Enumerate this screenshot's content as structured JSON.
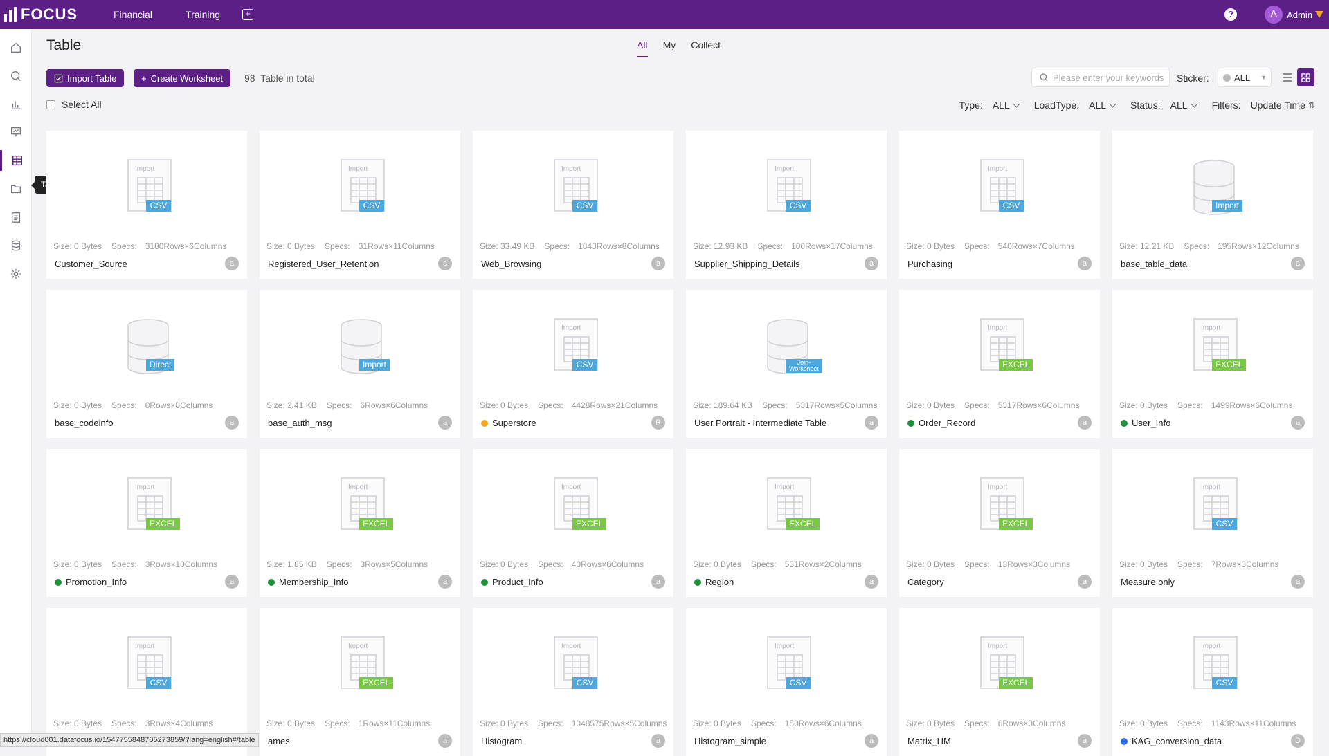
{
  "app": {
    "name": "FOCUS"
  },
  "topnav": {
    "items": [
      "Financial",
      "Training"
    ],
    "add_symbol": "+"
  },
  "user": {
    "initial": "A",
    "name": "Admin",
    "help": "?"
  },
  "sidebar": {
    "items": [
      {
        "icon": "home-icon"
      },
      {
        "icon": "search-icon"
      },
      {
        "icon": "chart-icon"
      },
      {
        "icon": "presentation-icon"
      },
      {
        "icon": "table-icon",
        "active": true
      },
      {
        "icon": "folder-icon"
      },
      {
        "icon": "clipboard-icon"
      },
      {
        "icon": "database-icon"
      },
      {
        "icon": "gear-icon"
      }
    ],
    "tooltip": "Tables"
  },
  "page": {
    "title": "Table"
  },
  "tabs": [
    {
      "label": "All",
      "active": true
    },
    {
      "label": "My"
    },
    {
      "label": "Collect"
    }
  ],
  "toolbar": {
    "import_label": "Import Table",
    "create_label": "Create Worksheet",
    "count_num": "98",
    "count_text": "Table in total",
    "search_placeholder": "Please enter your keywords",
    "sticker_label": "Sticker:",
    "sticker_value": "ALL",
    "select_all": "Select All"
  },
  "filters": {
    "type_label": "Type:",
    "type_value": "ALL",
    "load_label": "LoadType:",
    "load_value": "ALL",
    "status_label": "Status:",
    "status_value": "ALL",
    "filters_label": "Filters:",
    "sort_value": "Update Time"
  },
  "colors": {
    "brand": "#5c1f85",
    "csv": "#4da8e0",
    "excel": "#7ac943",
    "green": "#1e8f3a",
    "orange": "#f5a623",
    "blue": "#2b6be0"
  },
  "cards": [
    {
      "name": "Customer_Source",
      "size": "Size: 0 Bytes",
      "specs": "3180Rows×6Columns",
      "kind": "table",
      "tag": "CSV",
      "badge": "a",
      "dot": ""
    },
    {
      "name": "Registered_User_Retention",
      "size": "Size: 0 Bytes",
      "specs": "31Rows×11Columns",
      "kind": "table",
      "tag": "CSV",
      "badge": "a",
      "dot": ""
    },
    {
      "name": "Web_Browsing",
      "size": "Size: 33.49 KB",
      "specs": "1843Rows×8Columns",
      "kind": "table",
      "tag": "CSV",
      "badge": "a",
      "dot": ""
    },
    {
      "name": "Supplier_Shipping_Details",
      "size": "Size: 12.93 KB",
      "specs": "100Rows×17Columns",
      "kind": "table",
      "tag": "CSV",
      "badge": "a",
      "dot": ""
    },
    {
      "name": "Purchasing",
      "size": "Size: 0 Bytes",
      "specs": "540Rows×7Columns",
      "kind": "table",
      "tag": "CSV",
      "badge": "a",
      "dot": ""
    },
    {
      "name": "base_table_data",
      "size": "Size: 12.21 KB",
      "specs": "195Rows×12Columns",
      "kind": "db",
      "tag": "Import",
      "badge": "a",
      "dot": ""
    },
    {
      "name": "base_codeinfo",
      "size": "Size: 0 Bytes",
      "specs": "0Rows×8Columns",
      "kind": "db",
      "tag": "Direct",
      "badge": "a",
      "dot": ""
    },
    {
      "name": "base_auth_msg",
      "size": "Size: 2.41 KB",
      "specs": "6Rows×6Columns",
      "kind": "db",
      "tag": "Import",
      "badge": "a",
      "dot": ""
    },
    {
      "name": "Superstore",
      "size": "Size: 0 Bytes",
      "specs": "4428Rows×21Columns",
      "kind": "table",
      "tag": "CSV",
      "badge": "R",
      "dot": "orange"
    },
    {
      "name": "User Portrait - Intermediate Table",
      "size": "Size: 189.64 KB",
      "specs": "5317Rows×5Columns",
      "kind": "db",
      "tag": "Join-Worksheet",
      "badge": "a",
      "dot": ""
    },
    {
      "name": "Order_Record",
      "size": "Size: 0 Bytes",
      "specs": "5317Rows×6Columns",
      "kind": "table",
      "tag": "EXCEL",
      "badge": "a",
      "dot": "green"
    },
    {
      "name": "User_Info",
      "size": "Size: 0 Bytes",
      "specs": "1499Rows×6Columns",
      "kind": "table",
      "tag": "EXCEL",
      "badge": "a",
      "dot": "green"
    },
    {
      "name": "Promotion_Info",
      "size": "Size: 0 Bytes",
      "specs": "3Rows×10Columns",
      "kind": "table",
      "tag": "EXCEL",
      "badge": "a",
      "dot": "green"
    },
    {
      "name": "Membership_Info",
      "size": "Size: 1.85 KB",
      "specs": "3Rows×5Columns",
      "kind": "table",
      "tag": "EXCEL",
      "badge": "a",
      "dot": "green"
    },
    {
      "name": "Product_Info",
      "size": "Size: 0 Bytes",
      "specs": "40Rows×6Columns",
      "kind": "table",
      "tag": "EXCEL",
      "badge": "a",
      "dot": "green"
    },
    {
      "name": "Region",
      "size": "Size: 0 Bytes",
      "specs": "531Rows×2Columns",
      "kind": "table",
      "tag": "EXCEL",
      "badge": "a",
      "dot": "green"
    },
    {
      "name": "Category",
      "size": "Size: 0 Bytes",
      "specs": "13Rows×3Columns",
      "kind": "table",
      "tag": "EXCEL",
      "badge": "a",
      "dot": ""
    },
    {
      "name": "Measure only",
      "size": "Size: 0 Bytes",
      "specs": "7Rows×3Columns",
      "kind": "table",
      "tag": "CSV",
      "badge": "a",
      "dot": ""
    },
    {
      "name": "",
      "size": "Size: 0 Bytes",
      "specs": "3Rows×4Columns",
      "kind": "table",
      "tag": "CSV",
      "badge": "",
      "dot": ""
    },
    {
      "name": "ames",
      "size": "Size: 0 Bytes",
      "specs": "1Rows×11Columns",
      "kind": "table",
      "tag": "EXCEL",
      "badge": "a",
      "dot": ""
    },
    {
      "name": "Histogram",
      "size": "Size: 0 Bytes",
      "specs": "1048575Rows×5Columns",
      "kind": "table",
      "tag": "CSV",
      "badge": "a",
      "dot": ""
    },
    {
      "name": "Histogram_simple",
      "size": "Size: 0 Bytes",
      "specs": "150Rows×6Columns",
      "kind": "table",
      "tag": "CSV",
      "badge": "a",
      "dot": ""
    },
    {
      "name": "Matrix_HM",
      "size": "Size: 0 Bytes",
      "specs": "6Rows×3Columns",
      "kind": "table",
      "tag": "EXCEL",
      "badge": "a",
      "dot": ""
    },
    {
      "name": "KAG_conversion_data",
      "size": "Size: 0 Bytes",
      "specs": "1143Rows×11Columns",
      "kind": "table",
      "tag": "CSV",
      "badge": "D",
      "dot": "blue"
    }
  ],
  "card_labels": {
    "specs": "Specs:",
    "import": "Import"
  },
  "statusbar": {
    "url": "https://cloud001.datafocus.io/1547755848705273859/?lang=english#/table"
  }
}
